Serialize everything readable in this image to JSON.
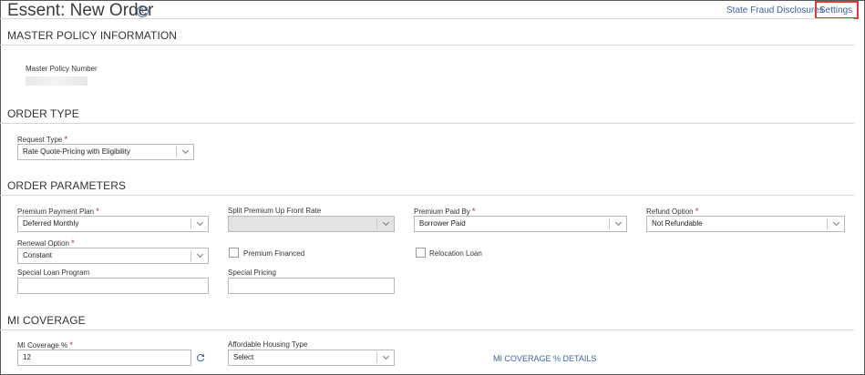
{
  "header": {
    "title": "Essent: New Order",
    "info_icon": "info-icon",
    "links": {
      "fraud": "State Fraud Disclosures",
      "settings": "Settings"
    }
  },
  "master_policy": {
    "heading": "MASTER POLICY INFORMATION",
    "number_label": "Master Policy Number"
  },
  "order_type": {
    "heading": "ORDER TYPE",
    "request_type": {
      "label": "Request Type",
      "required": "*",
      "value": "Rate Quote-Pricing with Eligibility"
    }
  },
  "order_parameters": {
    "heading": "ORDER PARAMETERS",
    "premium_payment_plan": {
      "label": "Premium Payment Plan",
      "required": "*",
      "value": "Deferred Monthly"
    },
    "split_premium": {
      "label": "Split Premium Up Front Rate",
      "value": ""
    },
    "premium_paid_by": {
      "label": "Premium Paid By",
      "required": "*",
      "value": "Borrower Paid"
    },
    "refund_option": {
      "label": "Refund Option",
      "required": "*",
      "value": "Not Refundable"
    },
    "renewal_option": {
      "label": "Renewal Option",
      "required": "*",
      "value": "Constant"
    },
    "premium_financed": {
      "label": "Premium Financed"
    },
    "relocation_loan": {
      "label": "Relocation Loan"
    },
    "special_loan_program": {
      "label": "Special Loan Program",
      "value": ""
    },
    "special_pricing": {
      "label": "Special Pricing",
      "value": ""
    }
  },
  "mi_coverage": {
    "heading": "MI COVERAGE",
    "coverage_pct": {
      "label": "MI Coverage %",
      "required": "*",
      "value": "12"
    },
    "affordable_housing": {
      "label": "Affordable Housing Type",
      "value": "Select"
    },
    "details_link": "MI COVERAGE % DETAILS"
  },
  "colors": {
    "link": "#3f63a6",
    "required": "#b0222e",
    "highlight": "#e03a3a"
  }
}
